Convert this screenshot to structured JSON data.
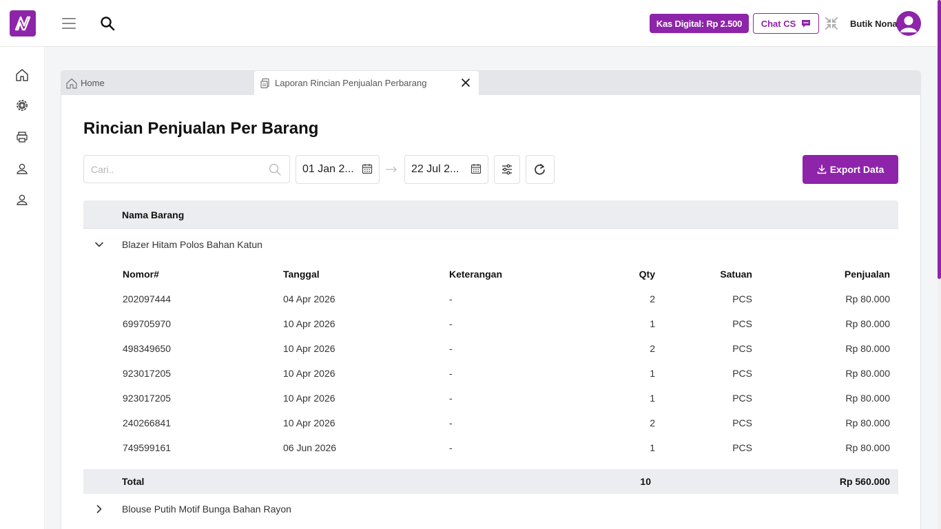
{
  "header": {
    "kas_digital": "Kas Digital: Rp 2.500",
    "chat_cs": "Chat CS",
    "username": "Butik Nona"
  },
  "sidebar": {
    "items": [
      {
        "icon": "home-icon"
      },
      {
        "icon": "settings-gear-icon"
      },
      {
        "icon": "printer-icon"
      },
      {
        "icon": "user-icon"
      },
      {
        "icon": "user-icon"
      }
    ]
  },
  "tabs": [
    {
      "label": "Home",
      "icon": "home-icon"
    },
    {
      "label": "Laporan Rincian Penjualan Perbarang",
      "icon": "report-icon",
      "active": true
    }
  ],
  "page": {
    "title": "Rincian Penjualan Per Barang"
  },
  "filters": {
    "search_placeholder": "Cari..",
    "date_from": "01 Jan 2...",
    "date_to": "22 Jul 2...",
    "export_label": "Export Data"
  },
  "table": {
    "column_header": "Nama Barang",
    "groups": [
      {
        "name": "Blazer Hitam Polos Bahan Katun",
        "expanded": true,
        "sub_columns": [
          "Nomor#",
          "Tanggal",
          "Keterangan",
          "Qty",
          "Satuan",
          "Penjualan"
        ],
        "rows": [
          {
            "nomor": "202097444",
            "tanggal": "04 Apr 2026",
            "keterangan": "-",
            "qty": "2",
            "satuan": "PCS",
            "penjualan": "Rp 80.000"
          },
          {
            "nomor": "699705970",
            "tanggal": "10 Apr 2026",
            "keterangan": "-",
            "qty": "1",
            "satuan": "PCS",
            "penjualan": "Rp 80.000"
          },
          {
            "nomor": "498349650",
            "tanggal": "10 Apr 2026",
            "keterangan": "-",
            "qty": "2",
            "satuan": "PCS",
            "penjualan": "Rp 80.000"
          },
          {
            "nomor": "923017205",
            "tanggal": "10 Apr 2026",
            "keterangan": "-",
            "qty": "1",
            "satuan": "PCS",
            "penjualan": "Rp 80.000"
          },
          {
            "nomor": "923017205",
            "tanggal": "10 Apr 2026",
            "keterangan": "-",
            "qty": "1",
            "satuan": "PCS",
            "penjualan": "Rp 80.000"
          },
          {
            "nomor": "240266841",
            "tanggal": "10 Apr 2026",
            "keterangan": "-",
            "qty": "2",
            "satuan": "PCS",
            "penjualan": "Rp 80.000"
          },
          {
            "nomor": "749599161",
            "tanggal": "06 Jun 2026",
            "keterangan": "-",
            "qty": "1",
            "satuan": "PCS",
            "penjualan": "Rp 80.000"
          }
        ],
        "total": {
          "label": "Total",
          "qty": "10",
          "penjualan": "Rp 560.000"
        }
      },
      {
        "name": "Blouse Putih Motif Bunga Bahan Rayon",
        "expanded": false
      }
    ]
  },
  "colors": {
    "brand": "#8e24aa"
  }
}
